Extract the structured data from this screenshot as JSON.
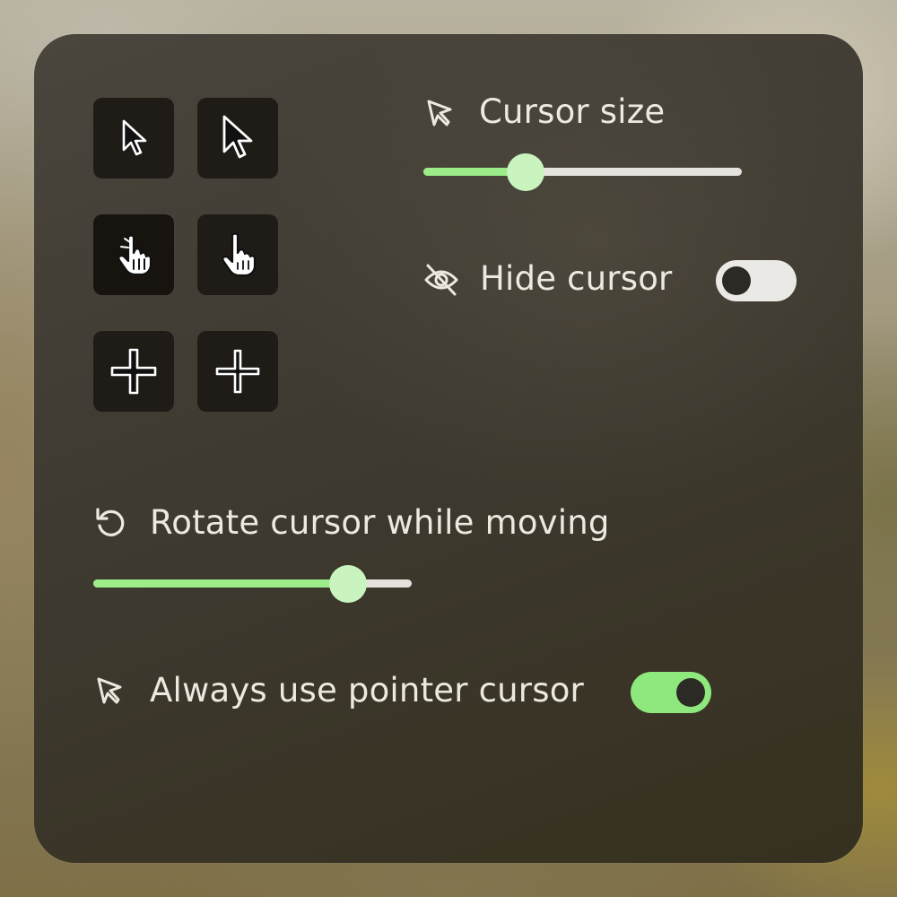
{
  "cursor_styles": {
    "tiles": [
      {
        "name": "arrow-small-icon"
      },
      {
        "name": "arrow-large-icon"
      },
      {
        "name": "hand-small-icon"
      },
      {
        "name": "hand-large-icon"
      },
      {
        "name": "crosshair-small-icon"
      },
      {
        "name": "crosshair-large-icon"
      }
    ]
  },
  "cursor_size": {
    "label": "Cursor size",
    "icon": "pointer-icon",
    "value_fraction": 0.32
  },
  "hide_cursor": {
    "label": "Hide cursor",
    "icon": "eye-off-icon",
    "enabled": false
  },
  "rotate_cursor": {
    "label": "Rotate cursor while moving",
    "icon": "rotate-icon",
    "value_fraction": 0.8
  },
  "pointer_cursor": {
    "label": "Always use pointer cursor",
    "icon": "pointer-icon",
    "enabled": true
  },
  "colors": {
    "accent": "#9cec8a",
    "thumb": "#c9f4bf",
    "toggle_on": "#8fe87d",
    "toggle_off": "#ebe9e6",
    "tile": "#1f1c17",
    "panel": "#3f3b32",
    "text": "#ece9e1"
  }
}
